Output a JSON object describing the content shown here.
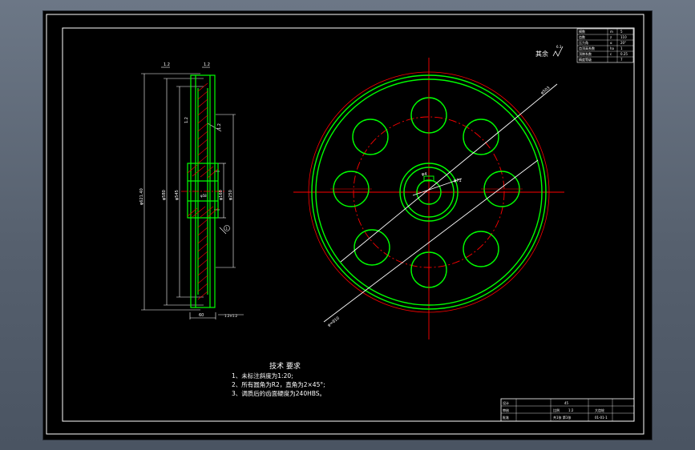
{
  "window": {
    "background_color": "#5b6675",
    "sheet_color": "#000000"
  },
  "colors": {
    "frame": "#ffffff",
    "outline": "#00ff00",
    "centerline": "#ff0000",
    "dimension": "#ffffff",
    "hatch": "#ff0000"
  },
  "roughness": {
    "label": "其余",
    "symbol_value": "6.3"
  },
  "side_view": {
    "dims": {
      "top_a": "1.2",
      "top_b": "1.2",
      "outer_diameter": "φ621.40",
      "root_diameter": "φ580",
      "pitch_diameter": "φ545",
      "rim_dim": "1.2",
      "hub_dim": "1.2",
      "hub_diameter": "φ250",
      "bore_diameter": "φ160",
      "bore_small": "φ58",
      "width": "60",
      "keyway": "1.2×1.2",
      "callout": "1"
    }
  },
  "front_view": {
    "dims": {
      "tip_diameter": "φ503",
      "hole_circle": "φ71",
      "small_hole": "φ4",
      "root_circle": "φ=810"
    }
  },
  "tech_requirements": {
    "title": "技术 要求",
    "items": [
      "1、未标注斜度为1:20;",
      "2、所有圆角为R2，直角为2×45°;",
      "3、调质后的齿面硬度为240HBS。"
    ]
  },
  "param_table": {
    "rows": [
      {
        "label": "模数",
        "symbol": "m",
        "value": "5"
      },
      {
        "label": "齿数",
        "symbol": "z",
        "value": "110"
      },
      {
        "label": "压力角",
        "symbol": "α",
        "value": "20°"
      },
      {
        "label": "齿顶高系数",
        "symbol": "ha",
        "value": "1"
      },
      {
        "label": "顶隙系数",
        "symbol": "c",
        "value": "0.25"
      },
      {
        "label": "精度等级",
        "symbol": "",
        "value": "7"
      }
    ]
  },
  "title_block": {
    "part_name": "大齿轮",
    "row1": "设计",
    "row2": "审核",
    "row3": "批准",
    "material": "45",
    "scale_label": "比例",
    "scale_value": "1:2",
    "sheet_label": "共1张 第1张",
    "drawing_number": "01-01-1"
  }
}
